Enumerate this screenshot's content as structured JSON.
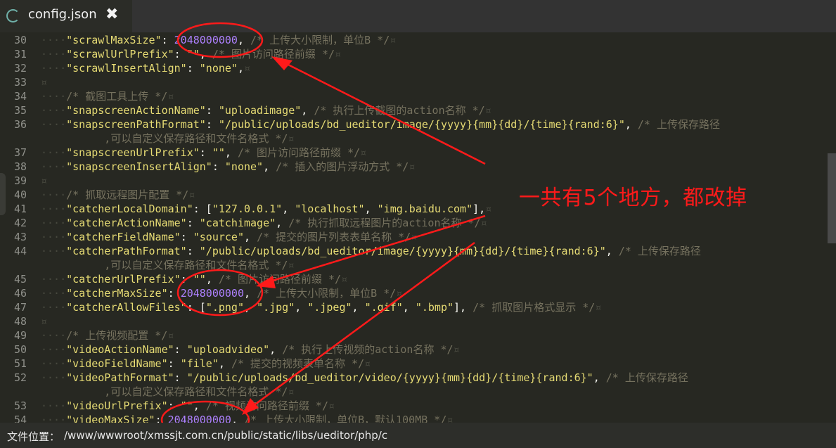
{
  "tab": {
    "title": "config.json",
    "close_glyph": "✖",
    "icon": "file-type-icon"
  },
  "lines": [
    {
      "n": "30",
      "segs": [
        [
          "ws",
          "····"
        ],
        [
          "key",
          "\"scrawlMaxSize\""
        ],
        [
          "punc",
          ": "
        ],
        [
          "num",
          "2048000000"
        ],
        [
          "punc",
          ", "
        ],
        [
          "cmt",
          "/* 上传大小限制，单位B */"
        ],
        [
          "nl",
          "¤"
        ]
      ]
    },
    {
      "n": "31",
      "segs": [
        [
          "ws",
          "····"
        ],
        [
          "key",
          "\"scrawlUrlPrefix\""
        ],
        [
          "punc",
          ": "
        ],
        [
          "str",
          "\"\""
        ],
        [
          "punc",
          ", "
        ],
        [
          "cmt",
          "/* 图片访问路径前缀 */"
        ],
        [
          "nl",
          "¤"
        ]
      ]
    },
    {
      "n": "32",
      "segs": [
        [
          "ws",
          "····"
        ],
        [
          "key",
          "\"scrawlInsertAlign\""
        ],
        [
          "punc",
          ": "
        ],
        [
          "str",
          "\"none\""
        ],
        [
          "punc",
          ","
        ],
        [
          "nl",
          "¤"
        ]
      ]
    },
    {
      "n": "33",
      "segs": [
        [
          "nl",
          "¤"
        ]
      ]
    },
    {
      "n": "34",
      "segs": [
        [
          "ws",
          "····"
        ],
        [
          "cmt",
          "/* 截图工具上传 */"
        ],
        [
          "nl",
          "¤"
        ]
      ]
    },
    {
      "n": "35",
      "segs": [
        [
          "ws",
          "····"
        ],
        [
          "key",
          "\"snapscreenActionName\""
        ],
        [
          "punc",
          ": "
        ],
        [
          "str",
          "\"uploadimage\""
        ],
        [
          "punc",
          ", "
        ],
        [
          "cmt",
          "/* 执行上传截图的action名称 */"
        ],
        [
          "nl",
          "¤"
        ]
      ]
    },
    {
      "n": "36",
      "segs": [
        [
          "ws",
          "····"
        ],
        [
          "key",
          "\"snapscreenPathFormat\""
        ],
        [
          "punc",
          ": "
        ],
        [
          "str",
          "\"/public/uploads/bd_ueditor/image/{yyyy}{mm}{dd}/{time}{rand:6}\""
        ],
        [
          "punc",
          ", "
        ],
        [
          "cmt",
          "/* 上传保存路径"
        ]
      ]
    },
    {
      "n": "",
      "segs": [
        [
          "cmt",
          "          ,可以自定义保存路径和文件名格式 */"
        ],
        [
          "nl",
          "¤"
        ]
      ]
    },
    {
      "n": "37",
      "segs": [
        [
          "ws",
          "····"
        ],
        [
          "key",
          "\"snapscreenUrlPrefix\""
        ],
        [
          "punc",
          ": "
        ],
        [
          "str",
          "\"\""
        ],
        [
          "punc",
          ", "
        ],
        [
          "cmt",
          "/* 图片访问路径前缀 */"
        ],
        [
          "nl",
          "¤"
        ]
      ]
    },
    {
      "n": "38",
      "segs": [
        [
          "ws",
          "····"
        ],
        [
          "key",
          "\"snapscreenInsertAlign\""
        ],
        [
          "punc",
          ": "
        ],
        [
          "str",
          "\"none\""
        ],
        [
          "punc",
          ", "
        ],
        [
          "cmt",
          "/* 插入的图片浮动方式 */"
        ],
        [
          "nl",
          "¤"
        ]
      ]
    },
    {
      "n": "39",
      "segs": [
        [
          "nl",
          "¤"
        ]
      ]
    },
    {
      "n": "40",
      "segs": [
        [
          "ws",
          "····"
        ],
        [
          "cmt",
          "/* 抓取远程图片配置 */"
        ],
        [
          "nl",
          "¤"
        ]
      ]
    },
    {
      "n": "41",
      "segs": [
        [
          "ws",
          "····"
        ],
        [
          "key",
          "\"catcherLocalDomain\""
        ],
        [
          "punc",
          ": ["
        ],
        [
          "str",
          "\"127.0.0.1\""
        ],
        [
          "punc",
          ", "
        ],
        [
          "str",
          "\"localhost\""
        ],
        [
          "punc",
          ", "
        ],
        [
          "str",
          "\"img.baidu.com\""
        ],
        [
          "punc",
          "],"
        ],
        [
          "nl",
          "¤"
        ]
      ]
    },
    {
      "n": "42",
      "segs": [
        [
          "ws",
          "····"
        ],
        [
          "key",
          "\"catcherActionName\""
        ],
        [
          "punc",
          ": "
        ],
        [
          "str",
          "\"catchimage\""
        ],
        [
          "punc",
          ", "
        ],
        [
          "cmt",
          "/* 执行抓取远程图片的action名称 */"
        ],
        [
          "nl",
          "¤"
        ]
      ]
    },
    {
      "n": "43",
      "segs": [
        [
          "ws",
          "····"
        ],
        [
          "key",
          "\"catcherFieldName\""
        ],
        [
          "punc",
          ": "
        ],
        [
          "str",
          "\"source\""
        ],
        [
          "punc",
          ", "
        ],
        [
          "cmt",
          "/* 提交的图片列表表单名称 */"
        ],
        [
          "nl",
          "¤"
        ]
      ]
    },
    {
      "n": "44",
      "segs": [
        [
          "ws",
          "····"
        ],
        [
          "key",
          "\"catcherPathFormat\""
        ],
        [
          "punc",
          ": "
        ],
        [
          "str",
          "\"/public/uploads/bd_ueditor/image/{yyyy}{mm}{dd}/{time}{rand:6}\""
        ],
        [
          "punc",
          ", "
        ],
        [
          "cmt",
          "/* 上传保存路径"
        ]
      ]
    },
    {
      "n": "",
      "segs": [
        [
          "cmt",
          "          ,可以自定义保存路径和文件名格式 */"
        ],
        [
          "nl",
          "¤"
        ]
      ]
    },
    {
      "n": "45",
      "segs": [
        [
          "ws",
          "····"
        ],
        [
          "key",
          "\"catcherUrlPrefix\""
        ],
        [
          "punc",
          ": "
        ],
        [
          "str",
          "\"\""
        ],
        [
          "punc",
          ", "
        ],
        [
          "cmt",
          "/* 图片访问路径前缀 */"
        ],
        [
          "nl",
          "¤"
        ]
      ]
    },
    {
      "n": "46",
      "segs": [
        [
          "ws",
          "····"
        ],
        [
          "key",
          "\"catcherMaxSize\""
        ],
        [
          "punc",
          ": "
        ],
        [
          "num",
          "2048000000"
        ],
        [
          "punc",
          ", "
        ],
        [
          "cmt",
          "/* 上传大小限制，单位B */"
        ],
        [
          "nl",
          "¤"
        ]
      ]
    },
    {
      "n": "47",
      "segs": [
        [
          "ws",
          "····"
        ],
        [
          "key",
          "\"catcherAllowFiles\""
        ],
        [
          "punc",
          ": ["
        ],
        [
          "str",
          "\".png\""
        ],
        [
          "punc",
          ", "
        ],
        [
          "str",
          "\".jpg\""
        ],
        [
          "punc",
          ", "
        ],
        [
          "str",
          "\".jpeg\""
        ],
        [
          "punc",
          ", "
        ],
        [
          "str",
          "\".gif\""
        ],
        [
          "punc",
          ", "
        ],
        [
          "str",
          "\".bmp\""
        ],
        [
          "punc",
          "], "
        ],
        [
          "cmt",
          "/* 抓取图片格式显示 */"
        ],
        [
          "nl",
          "¤"
        ]
      ]
    },
    {
      "n": "48",
      "segs": [
        [
          "nl",
          "¤"
        ]
      ]
    },
    {
      "n": "49",
      "segs": [
        [
          "ws",
          "····"
        ],
        [
          "cmt",
          "/* 上传视频配置 */"
        ],
        [
          "nl",
          "¤"
        ]
      ]
    },
    {
      "n": "50",
      "segs": [
        [
          "ws",
          "····"
        ],
        [
          "key",
          "\"videoActionName\""
        ],
        [
          "punc",
          ": "
        ],
        [
          "str",
          "\"uploadvideo\""
        ],
        [
          "punc",
          ", "
        ],
        [
          "cmt",
          "/* 执行上传视频的action名称 */"
        ],
        [
          "nl",
          "¤"
        ]
      ]
    },
    {
      "n": "51",
      "segs": [
        [
          "ws",
          "····"
        ],
        [
          "key",
          "\"videoFieldName\""
        ],
        [
          "punc",
          ": "
        ],
        [
          "str",
          "\"file\""
        ],
        [
          "punc",
          ", "
        ],
        [
          "cmt",
          "/* 提交的视频表单名称 */"
        ],
        [
          "nl",
          "¤"
        ]
      ]
    },
    {
      "n": "52",
      "segs": [
        [
          "ws",
          "····"
        ],
        [
          "key",
          "\"videoPathFormat\""
        ],
        [
          "punc",
          ": "
        ],
        [
          "str",
          "\"/public/uploads/bd_ueditor/video/{yyyy}{mm}{dd}/{time}{rand:6}\""
        ],
        [
          "punc",
          ", "
        ],
        [
          "cmt",
          "/* 上传保存路径"
        ]
      ]
    },
    {
      "n": "",
      "segs": [
        [
          "cmt",
          "          ,可以自定义保存路径和文件名格式 */"
        ],
        [
          "nl",
          "¤"
        ]
      ]
    },
    {
      "n": "53",
      "segs": [
        [
          "ws",
          "····"
        ],
        [
          "key",
          "\"videoUrlPrefix\""
        ],
        [
          "punc",
          ": "
        ],
        [
          "str",
          "\"\""
        ],
        [
          "punc",
          ", "
        ],
        [
          "cmt",
          "/* 视频访问路径前缀 */"
        ],
        [
          "nl",
          "¤"
        ]
      ]
    },
    {
      "n": "54",
      "segs": [
        [
          "ws",
          "····"
        ],
        [
          "key",
          "\"videoMaxSize\""
        ],
        [
          "punc",
          ": "
        ],
        [
          "num",
          "2048000000"
        ],
        [
          "punc",
          ", "
        ],
        [
          "cmt",
          "/* 上传大小限制，单位B，默认100MB */"
        ],
        [
          "nl",
          "¤"
        ]
      ]
    }
  ],
  "annotation": {
    "text": "一共有5个地方，都改掉",
    "color": "#ff1a1a"
  },
  "status": {
    "label": "文件位置：",
    "path": "/www/wwwroot/xmssjt.com.cn/public/static/libs/ueditor/php/c"
  },
  "theme": {
    "bg": "#272822",
    "key": "#e6db74",
    "number": "#ae81ff",
    "comment": "#75715e"
  }
}
